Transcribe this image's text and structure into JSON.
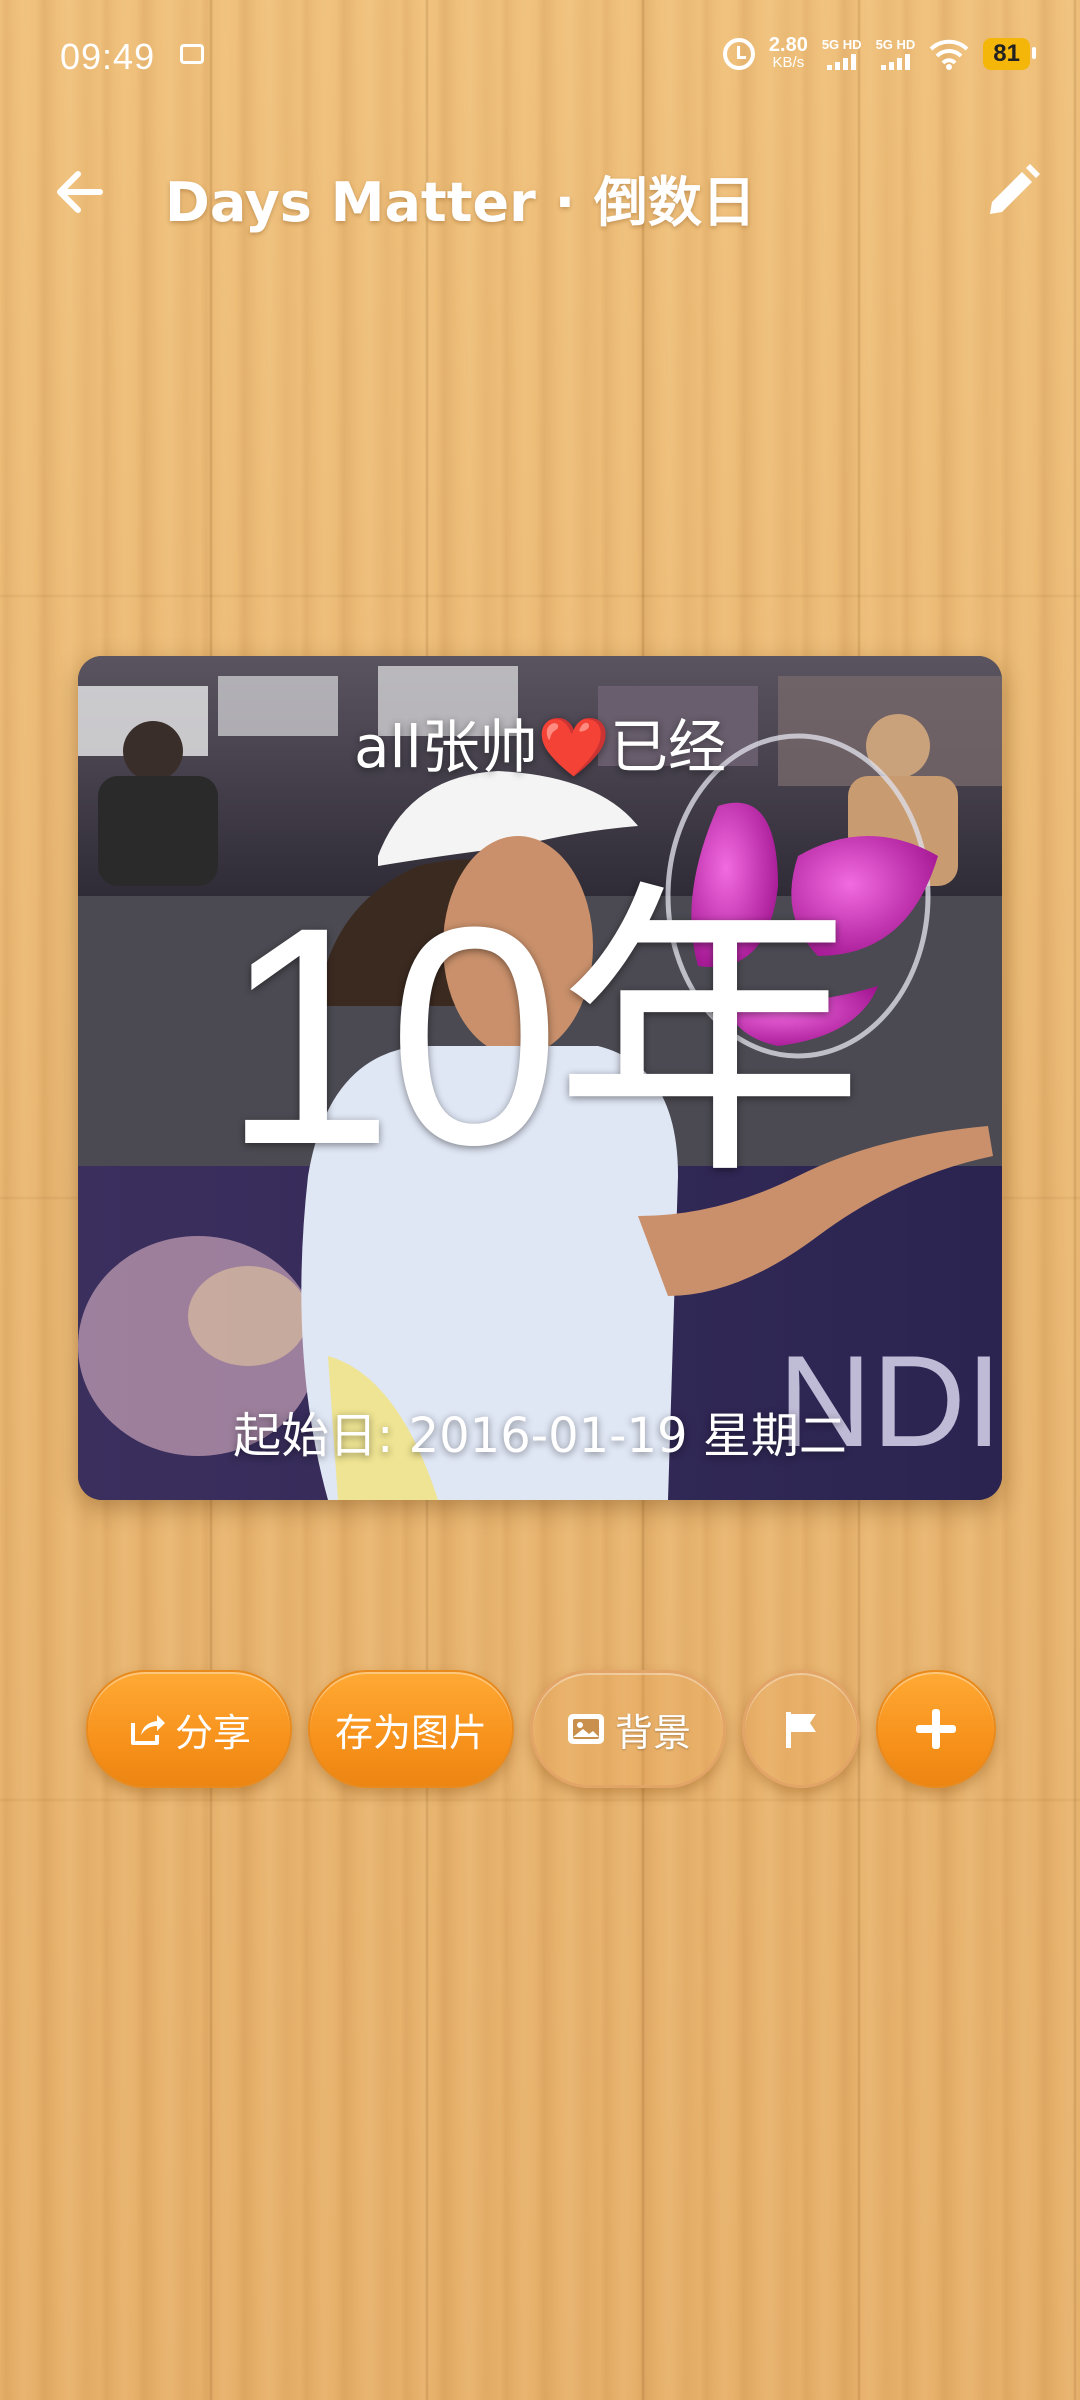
{
  "status_bar": {
    "time": "09:49",
    "net_speed_value": "2.80",
    "net_speed_unit": "KB/s",
    "signal1_label": "5G HD",
    "signal2_label": "5G HD",
    "battery": "81",
    "icons": [
      "tv-icon",
      "alarm-icon",
      "signal-icon",
      "wifi-icon",
      "battery-icon"
    ]
  },
  "header": {
    "title": "Days Matter · 倒数日",
    "back_icon": "arrow-left-icon",
    "edit_icon": "pencil-icon"
  },
  "card": {
    "top_text": "all张帅❤️已经",
    "count_text": "10年",
    "start_date_text": "起始日: 2016-01-19 星期二"
  },
  "actions": {
    "share_label": "分享",
    "save_image_label": "存为图片",
    "background_label": "背景",
    "flag_icon": "flag-icon",
    "add_icon": "plus-icon"
  },
  "colors": {
    "accent_orange": "#f7921c",
    "wood_base": "#e8b66f",
    "text_white": "#ffffff"
  }
}
